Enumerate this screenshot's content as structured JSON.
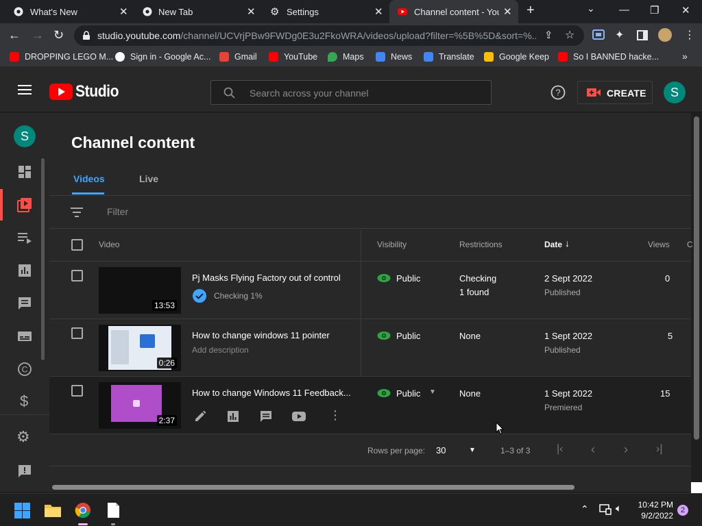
{
  "browser": {
    "tabs": [
      {
        "title": "What's New",
        "active": false
      },
      {
        "title": "New Tab",
        "active": false
      },
      {
        "title": "Settings",
        "active": false
      },
      {
        "title": "Channel content - YouTube Studio",
        "active": true
      }
    ],
    "url_host": "studio.youtube.com",
    "url_path": "/channel/UCVrjPBw9FWDg0E3u2FkoWRA/videos/upload?filter=%5B%5D&sort=%...",
    "bookmarks": [
      {
        "label": "DROPPING LEGO M...",
        "color": "#ff0000"
      },
      {
        "label": "Sign in - Google Ac...",
        "color": "#ffffff"
      },
      {
        "label": "Gmail",
        "color": "#ea4335"
      },
      {
        "label": "YouTube",
        "color": "#ff0000"
      },
      {
        "label": "Maps",
        "color": "#34a853"
      },
      {
        "label": "News",
        "color": "#4285f4"
      },
      {
        "label": "Translate",
        "color": "#4285f4"
      },
      {
        "label": "Google Keep",
        "color": "#fbbc04"
      },
      {
        "label": "So I BANNED hacke...",
        "color": "#ff0000"
      }
    ]
  },
  "studio": {
    "logo_text": "Studio",
    "search_placeholder": "Search across your channel",
    "create_label": "CREATE",
    "avatar_letter": "S",
    "page_title": "Channel content",
    "tabs": [
      {
        "label": "Videos",
        "active": true
      },
      {
        "label": "Live",
        "active": false
      }
    ],
    "filter_placeholder": "Filter",
    "columns": {
      "video": "Video",
      "visibility": "Visibility",
      "restrictions": "Restrictions",
      "date": "Date",
      "views": "Views",
      "comments": "C"
    },
    "rows": [
      {
        "title": "Pj Masks Flying Factory out of control",
        "subtitle": "Checking 1%",
        "duration": "13:53",
        "visibility": "Public",
        "restriction_line1": "Checking",
        "restriction_line2": "1 found",
        "date": "2 Sept 2022",
        "date_status": "Published",
        "views": "0"
      },
      {
        "title": "How to change windows 11 pointer",
        "subtitle": "Add description",
        "duration": "0:26",
        "visibility": "Public",
        "restriction_line1": "None",
        "restriction_line2": "",
        "date": "1 Sept 2022",
        "date_status": "Published",
        "views": "5"
      },
      {
        "title": "How to change Windows 11 Feedback...",
        "subtitle": "",
        "duration": "2:37",
        "visibility": "Public",
        "restriction_line1": "None",
        "restriction_line2": "",
        "date": "1 Sept 2022",
        "date_status": "Premiered",
        "views": "15"
      }
    ],
    "pager": {
      "rows_per_page_label": "Rows per page:",
      "rows_per_page": "30",
      "range": "1–3 of 3"
    }
  },
  "taskbar": {
    "time": "10:42 PM",
    "date": "9/2/2022",
    "notifications": "2"
  },
  "colors": {
    "accent_blue": "#3ea6ff",
    "youtube_red": "#ff0000",
    "public_green": "#2ba640",
    "avatar_teal": "#00897b"
  }
}
